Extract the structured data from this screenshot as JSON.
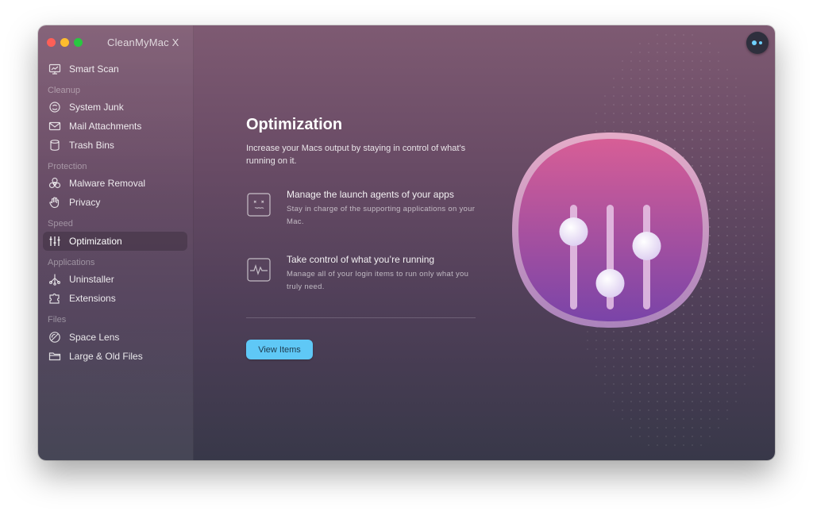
{
  "window": {
    "title": "CleanMyMac X"
  },
  "sidebar": {
    "items": [
      {
        "label": "Smart Scan",
        "icon": "monitor-icon"
      },
      {
        "label": "System Junk",
        "icon": "junk-icon"
      },
      {
        "label": "Mail Attachments",
        "icon": "mail-icon"
      },
      {
        "label": "Trash Bins",
        "icon": "trash-icon"
      },
      {
        "label": "Malware Removal",
        "icon": "biohazard-icon"
      },
      {
        "label": "Privacy",
        "icon": "hand-icon"
      },
      {
        "label": "Optimization",
        "icon": "sliders-icon",
        "active": true
      },
      {
        "label": "Uninstaller",
        "icon": "uninstaller-icon"
      },
      {
        "label": "Extensions",
        "icon": "extensions-icon"
      },
      {
        "label": "Space Lens",
        "icon": "lens-icon"
      },
      {
        "label": "Large & Old Files",
        "icon": "folder-icon"
      }
    ],
    "sections": [
      "Cleanup",
      "Protection",
      "Speed",
      "Applications",
      "Files"
    ]
  },
  "main": {
    "title": "Optimization",
    "description": "Increase your Macs output by staying in control of what’s running on it.",
    "features": [
      {
        "title": "Manage the launch agents of your apps",
        "description": "Stay in charge of the supporting applications on your Mac.",
        "icon": "launch-agent-icon"
      },
      {
        "title": "Take control of what you’re running",
        "description": "Manage all of your login items to run only what you truly need.",
        "icon": "activity-icon"
      }
    ],
    "button_label": "View Items"
  },
  "colors": {
    "accent": "#5fc8f6",
    "icon_gradient_top": "#d75e96",
    "icon_gradient_bottom": "#7a44a8"
  }
}
